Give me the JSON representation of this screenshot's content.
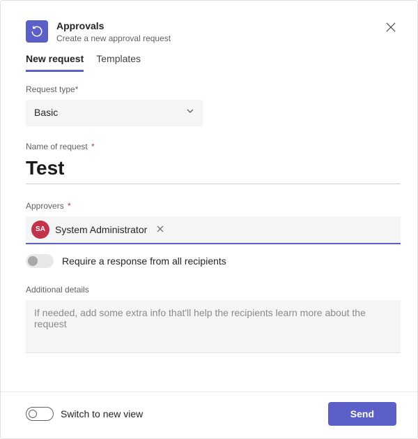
{
  "header": {
    "title": "Approvals",
    "subtitle": "Create a new approval request"
  },
  "tabs": {
    "new_request": "New request",
    "templates": "Templates"
  },
  "form": {
    "request_type_label": "Request type*",
    "request_type_value": "Basic",
    "name_label": "Name of request ",
    "name_value": "Test",
    "approvers_label": "Approvers ",
    "approver": {
      "initials": "SA",
      "name": "System Administrator"
    },
    "require_response_label": "Require a response from all recipients",
    "additional_details_label": "Additional details",
    "additional_details_placeholder": "If needed, add some extra info that'll help the recipients learn more about the request"
  },
  "footer": {
    "switch_view_label": "Switch to new view",
    "send_label": "Send"
  }
}
